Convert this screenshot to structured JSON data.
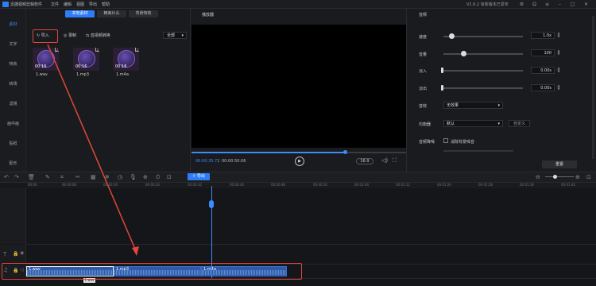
{
  "app": {
    "title": "迅捷视频剪辑软件",
    "menus": [
      "文件",
      "编辑",
      "视图",
      "导出",
      "帮助"
    ],
    "version": "V1.6.2",
    "notice": "V1.6.2 有新版本已发布"
  },
  "left_nav": [
    "素材",
    "文字",
    "特效",
    "转场",
    "滤镜",
    "画中画",
    "贴纸",
    "配乐"
  ],
  "media": {
    "tabs": [
      "本地素材",
      "精美片头",
      "背景特效"
    ],
    "import_label": "导入",
    "record_label": "录制",
    "convert_label": "音视频转换",
    "filter_value": "全部",
    "items": [
      {
        "name": "1.wav",
        "duration": "00:16"
      },
      {
        "name": "1.mp3",
        "duration": "00:16"
      },
      {
        "name": "1.m4a",
        "duration": "00:16"
      }
    ]
  },
  "player": {
    "title": "播放器",
    "current_time": "00:00:35.71",
    "total_time": "00:00:50.06",
    "progress": 0.72,
    "ratio": "16:9"
  },
  "properties": {
    "title": "音频",
    "speed": {
      "label": "速度",
      "value": "1.0x",
      "level": 0.1
    },
    "volume": {
      "label": "音量",
      "value": "100",
      "level": 0.25
    },
    "fade_in": {
      "label": "淡入",
      "value": "0.00s"
    },
    "fade_out": {
      "label": "淡出",
      "value": "0.00s"
    },
    "effect": {
      "label": "音效",
      "value": "无效果"
    },
    "equalizer": {
      "label": "均衡器",
      "value": "默认",
      "custom": "自定义"
    },
    "denoise": {
      "label": "音频降噪",
      "option": "消除背景噪音"
    },
    "reset": "重置"
  },
  "timeline": {
    "export_label": "导出",
    "ticks": [
      "00:00",
      "00:00:08",
      "00:00:16",
      "00:00:24",
      "00:00:32",
      "00:00:40",
      "00:00:48",
      "00:00:56",
      "00:01:04",
      "00:01:12",
      "00:01:20",
      "00:01:28",
      "00:01:36",
      "00:01:44"
    ],
    "clips": [
      {
        "name": "1.wav",
        "duration": "16"
      },
      {
        "name": "1.mp3",
        "duration": "16"
      },
      {
        "name": "1.m4a",
        "duration": "16"
      }
    ],
    "tooltip": "1.wav"
  },
  "colors": {
    "accent": "#2f7df6",
    "highlight": "#e0463c"
  }
}
